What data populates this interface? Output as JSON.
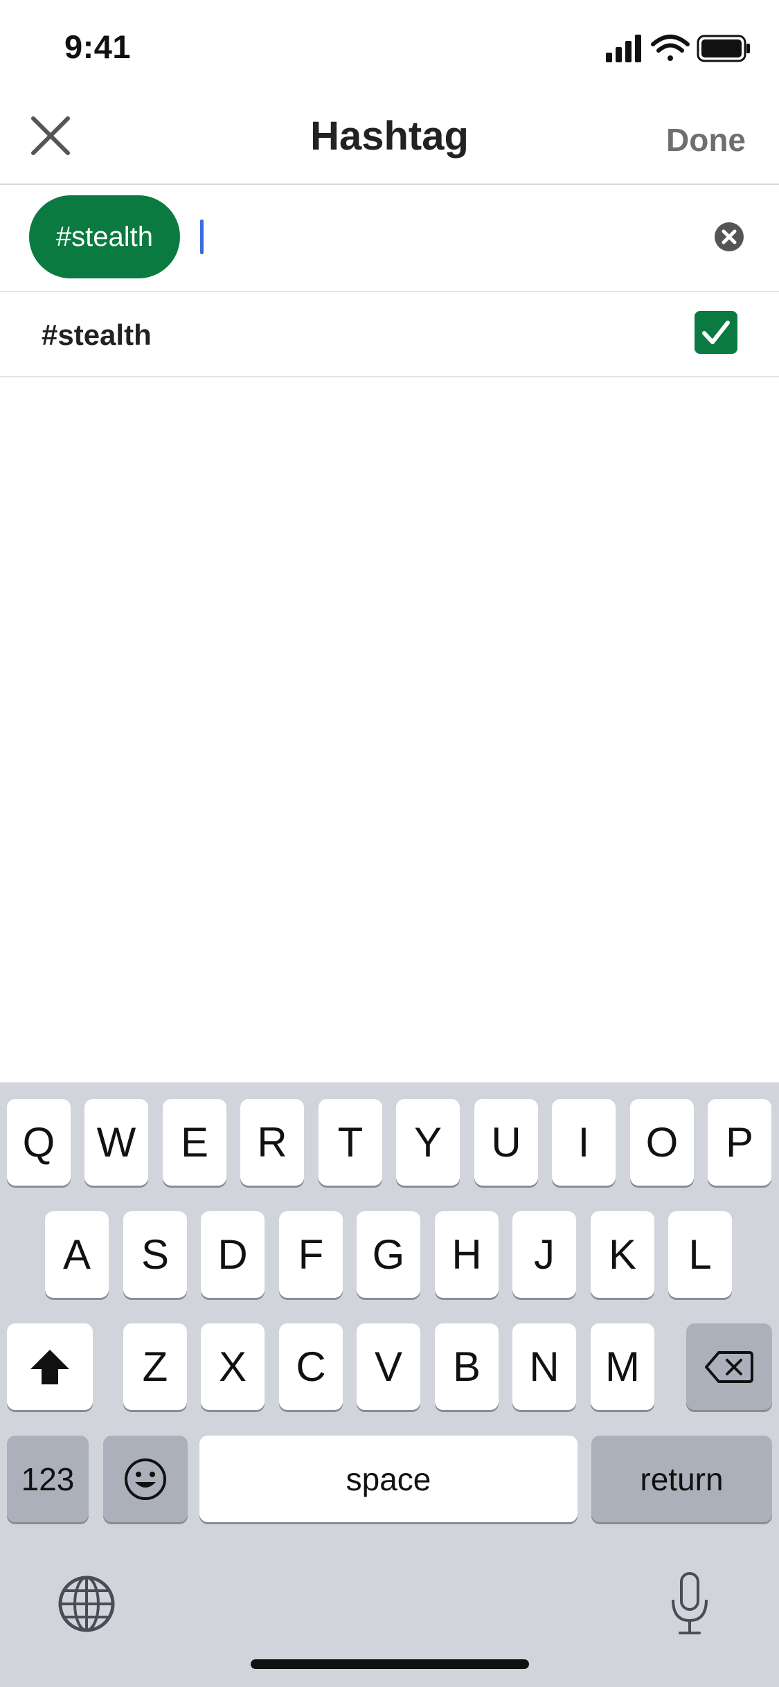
{
  "status_bar": {
    "time": "9:41"
  },
  "nav": {
    "title": "Hashtag",
    "done_label": "Done",
    "close_icon": "close-icon"
  },
  "search": {
    "chip_label": "#stealth",
    "value": ""
  },
  "results": [
    {
      "label": "#stealth",
      "checked": true
    }
  ],
  "keyboard": {
    "row1": [
      "Q",
      "W",
      "E",
      "R",
      "T",
      "Y",
      "U",
      "I",
      "O",
      "P"
    ],
    "row2": [
      "A",
      "S",
      "D",
      "F",
      "G",
      "H",
      "J",
      "K",
      "L"
    ],
    "row3": [
      "Z",
      "X",
      "C",
      "V",
      "B",
      "N",
      "M"
    ],
    "numbers_label": "123",
    "space_label": "space",
    "return_label": "return"
  },
  "colors": {
    "accent_green": "#0b7a40",
    "caret_blue": "#3a6ce0",
    "keyboard_bg": "#d1d4db"
  }
}
